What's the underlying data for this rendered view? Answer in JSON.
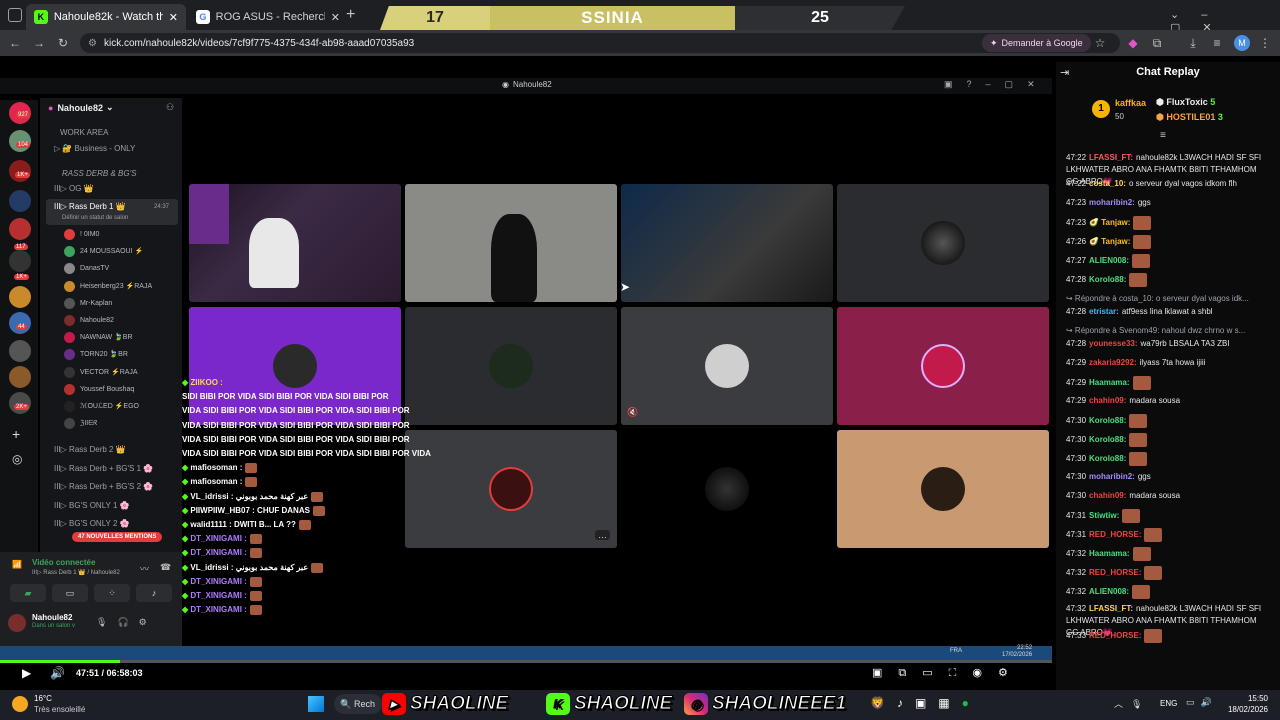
{
  "browser": {
    "tabs": [
      {
        "label": "Nahoule82k - Watch the VOD o"
      },
      {
        "label": "ROG ASUS - Recherche Google"
      }
    ],
    "url": "kick.com/nahoule82k/videos/7cf9f775-4375-434f-ab98-aaad07035a93",
    "ask_google": "Demander à Google",
    "profile_initial": "M"
  },
  "scoreboard": {
    "left": "17",
    "center": "SSINIA",
    "right": "25"
  },
  "discord": {
    "window_title": "Nahoule82",
    "server_name": "Nahoule82",
    "badges": [
      "927",
      "104",
      "1K+",
      "117",
      "1K+",
      "44",
      "2K+"
    ],
    "channels": [
      {
        "label": "WORK AREA"
      },
      {
        "label": "▷ 🔐 Business - ONLY"
      },
      {
        "label": "RASS DERB & BG'S"
      },
      {
        "label": "III▷ OG 👑"
      },
      {
        "label": "III▷ Rass Derb 1 👑",
        "timer": "24:37"
      },
      {
        "label": "Définir un statut de salon"
      }
    ],
    "members": [
      {
        "name": "! 0IM0"
      },
      {
        "name": "24 MOUSSAOUI ⚡"
      },
      {
        "name": "DanasTV"
      },
      {
        "name": "Heisenberg23 ⚡RAJA"
      },
      {
        "name": "Mr-Kaplan"
      },
      {
        "name": "Nahoule82"
      },
      {
        "name": "NAWNAW 🍃BR"
      },
      {
        "name": "TORN20 🍃BR"
      },
      {
        "name": "VECTOR ⚡RAJA"
      },
      {
        "name": "Youssef Boushaq"
      },
      {
        "name": "ℳOUℒED ⚡EGO"
      },
      {
        "name": "ℨIIᗴᖇ"
      }
    ],
    "more_channels": [
      {
        "label": "III▷ Rass Derb 2 👑"
      },
      {
        "label": "III▷ Rass Derb + BG'S 1 🌸"
      },
      {
        "label": "III▷ Rass Derb + BG'S 2 🌸"
      },
      {
        "label": "III▷ BG'S ONLY 1 🌸"
      },
      {
        "label": "III▷ BG'S ONLY 2 🌸"
      }
    ],
    "mentions": "47 NOUVELLES MENTIONS",
    "voice_status": "Vidéo connectée",
    "voice_channel": "III▷ Rass Derb 1 👑 / Nahoule82",
    "user_name": "Nahoule82",
    "user_status": "Dans un salon v"
  },
  "overlay_chat": [
    {
      "user": "ZIIKOO :",
      "color": "#ffd84d"
    },
    {
      "user": "SIDI BIBI POR VIDA SIDI BIBI POR VIDA SIDI BIBI POR",
      "color": "#ffffff"
    },
    {
      "user": "VIDA SIDI BIBI POR VIDA SIDI BIBI POR VIDA SIDI BIBI POR",
      "color": "#ffffff"
    },
    {
      "user": "VIDA SIDI BIBI POR VIDA SIDI BIBI POR VIDA SIDI BIBI POR",
      "color": "#ffffff"
    },
    {
      "user": "VIDA SIDI BIBI POR VIDA SIDI BIBI POR VIDA SIDI BIBI POR",
      "color": "#ffffff"
    },
    {
      "user": "VIDA SIDI BIBI POR VIDA SIDI BIBI POR VIDA SIDI BIBI POR VIDA",
      "color": "#ffffff"
    },
    {
      "user": "mafiosoman :",
      "color": "#ffffff"
    },
    {
      "user": "mafiosoman :",
      "color": "#ffffff"
    },
    {
      "user": "VL_idrissi : عبر كهنة محمد بوبوني",
      "color": "#ffffff"
    },
    {
      "user": "PIIWPIIW_HB07 : CHUF DANAS",
      "color": "#ffffff"
    },
    {
      "user": "walid1111 : DWITI B... LA ??",
      "color": "#ffffff"
    },
    {
      "user": "DT_XINIGAMI :",
      "color": "#b07cff"
    },
    {
      "user": "DT_XINIGAMI :",
      "color": "#b07cff"
    },
    {
      "user": "VL_idrissi : عبر كهنة محمد بوبوني",
      "color": "#ffffff"
    },
    {
      "user": "DT_XINIGAMI :",
      "color": "#b07cff"
    },
    {
      "user": "DT_XINIGAMI :",
      "color": "#b07cff"
    },
    {
      "user": "DT_XINIGAMI :",
      "color": "#b07cff"
    }
  ],
  "chat": {
    "title": "Chat Replay",
    "top": {
      "first": "kaffkaa",
      "first_score": "50",
      "second": "FluxToxic",
      "second_score": "5",
      "third": "HOSTILE01",
      "third_score": "3"
    },
    "messages": [
      {
        "time": "47:22",
        "user": "LFASSI_FT:",
        "color": "#ff5c5c",
        "text": "nahoule82k L3WACH HADI SF SFI LKHWATER ABRO ANA FHAMTK B8ITI TFHAMHOM GG ABRO💗",
        "emote": false
      },
      {
        "time": "47:22",
        "user": "costa_10:",
        "color": "#ffd84d",
        "text": "o serveur dyal vagos idkom flh",
        "emote": false
      },
      {
        "time": "47:23",
        "user": "moharibin2:",
        "color": "#a78bfa",
        "text": "ggs",
        "emote": false
      },
      {
        "time": "47:23",
        "user": "🥑 Tanjaw:",
        "color": "#fbbf24",
        "text": "",
        "emote": true
      },
      {
        "time": "47:26",
        "user": "🥑 Tanjaw:",
        "color": "#fbbf24",
        "text": "",
        "emote": true
      },
      {
        "time": "47:27",
        "user": "ALIEN008:",
        "color": "#4ade80",
        "text": "",
        "emote": true
      },
      {
        "time": "47:28",
        "user": "Korolo88:",
        "color": "#4ade80",
        "text": "",
        "emote": true
      },
      {
        "time": "",
        "user": "↪ Répondre à costa_10: o serveur dyal vagos idk...",
        "color": "#9ca3af",
        "text": "",
        "emote": false
      },
      {
        "time": "47:28",
        "user": "etristar:",
        "color": "#38bdf8",
        "text": "atf9ess lina lklawat a shbl",
        "emote": false
      },
      {
        "time": "",
        "user": "↪ Répondre à Svenom49: nahoul dwz chrno w s...",
        "color": "#9ca3af",
        "text": "",
        "emote": false
      },
      {
        "time": "47:28",
        "user": "younesse33:",
        "color": "#ef4444",
        "text": "wa79rb LBSALA TA3 ZBI",
        "emote": false
      },
      {
        "time": "47:29",
        "user": "zakaria9292:",
        "color": "#ef4444",
        "text": "ilyass 7ta howa ijiii",
        "emote": false
      },
      {
        "time": "47:29",
        "user": "Haamama:",
        "color": "#4ade80",
        "text": "",
        "emote": true
      },
      {
        "time": "47:29",
        "user": "chahin09:",
        "color": "#ef4444",
        "text": "madara sousa",
        "emote": false
      },
      {
        "time": "47:30",
        "user": "Korolo88:",
        "color": "#4ade80",
        "text": "",
        "emote": true
      },
      {
        "time": "47:30",
        "user": "Korolo88:",
        "color": "#4ade80",
        "text": "",
        "emote": true
      },
      {
        "time": "47:30",
        "user": "Korolo88:",
        "color": "#4ade80",
        "text": "",
        "emote": true
      },
      {
        "time": "47:30",
        "user": "moharibin2:",
        "color": "#a78bfa",
        "text": "ggs",
        "emote": false
      },
      {
        "time": "47:30",
        "user": "chahin09:",
        "color": "#ef4444",
        "text": "madara sousa",
        "emote": false
      },
      {
        "time": "47:31",
        "user": "Stiwtiw:",
        "color": "#4ade80",
        "text": "",
        "emote": true
      },
      {
        "time": "47:31",
        "user": "RED_HORSE:",
        "color": "#ef4444",
        "text": "",
        "emote": true
      },
      {
        "time": "47:32",
        "user": "Haamama:",
        "color": "#4ade80",
        "text": "",
        "emote": true
      },
      {
        "time": "47:32",
        "user": "RED_HORSE:",
        "color": "#ef4444",
        "text": "",
        "emote": true
      },
      {
        "time": "47:32",
        "user": "ALIEN008:",
        "color": "#4ade80",
        "text": "",
        "emote": true
      },
      {
        "time": "47:32",
        "user": "LFASSI_FT:",
        "color": "#ffd84d",
        "text": "nahoule82k L3WACH HADI SF SFI LKHWATER ABRO ANA FHAMTK B8ITI TFHAMHOM GG ABRO💗",
        "emote": false
      },
      {
        "time": "47:33",
        "user": "RED_HORSE:",
        "color": "#ef4444",
        "text": "",
        "emote": true
      }
    ]
  },
  "player": {
    "time": "47:51 / 06:58:03",
    "inner_clock": "22:52",
    "inner_date": "17/02/2026",
    "inner_lang": "FRA",
    "progress": 0.114
  },
  "taskbar": {
    "weather_temp": "16°C",
    "weather_desc": "Très ensoleillé",
    "search": "Rech",
    "brands": [
      {
        "name": "SHAOLINE",
        "icon": "youtube-icon"
      },
      {
        "name": "SHAOLINE",
        "icon": "kick-icon"
      },
      {
        "name": "SHAOLINEEE1",
        "icon": "instagram-icon"
      }
    ],
    "lang": "ENG",
    "time": "15:50",
    "date": "18/02/2026"
  }
}
